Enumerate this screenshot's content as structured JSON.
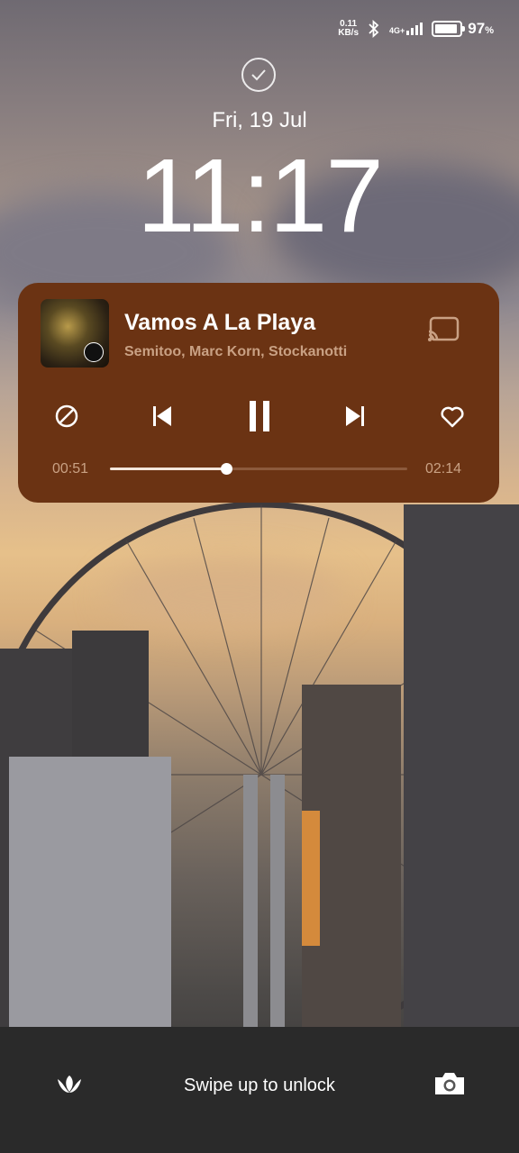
{
  "status": {
    "net_speed_value": "0.11",
    "net_speed_unit": "KB/s",
    "network_type": "4G+",
    "battery_percent": "97",
    "battery_sign": "%",
    "signal_level": 4
  },
  "lockscreen": {
    "date": "Fri, 19 Jul",
    "time": "11:17",
    "unlock_hint": "Swipe up to unlock"
  },
  "media": {
    "title": "Vamos A La Playa",
    "artist": "Semitoo, Marc Korn, Stockanotti",
    "elapsed": "00:51",
    "total": "02:14",
    "progress": 0.39,
    "accent_color": "#6b3313"
  },
  "icons": {
    "status": [
      "bluetooth-icon",
      "signal-icon",
      "battery-icon"
    ],
    "lock": "check-circle-icon",
    "media_controls": [
      "block-icon",
      "previous-icon",
      "pause-icon",
      "next-icon",
      "heart-icon",
      "cast-icon"
    ],
    "bottom": [
      "flower-icon",
      "camera-icon"
    ]
  }
}
